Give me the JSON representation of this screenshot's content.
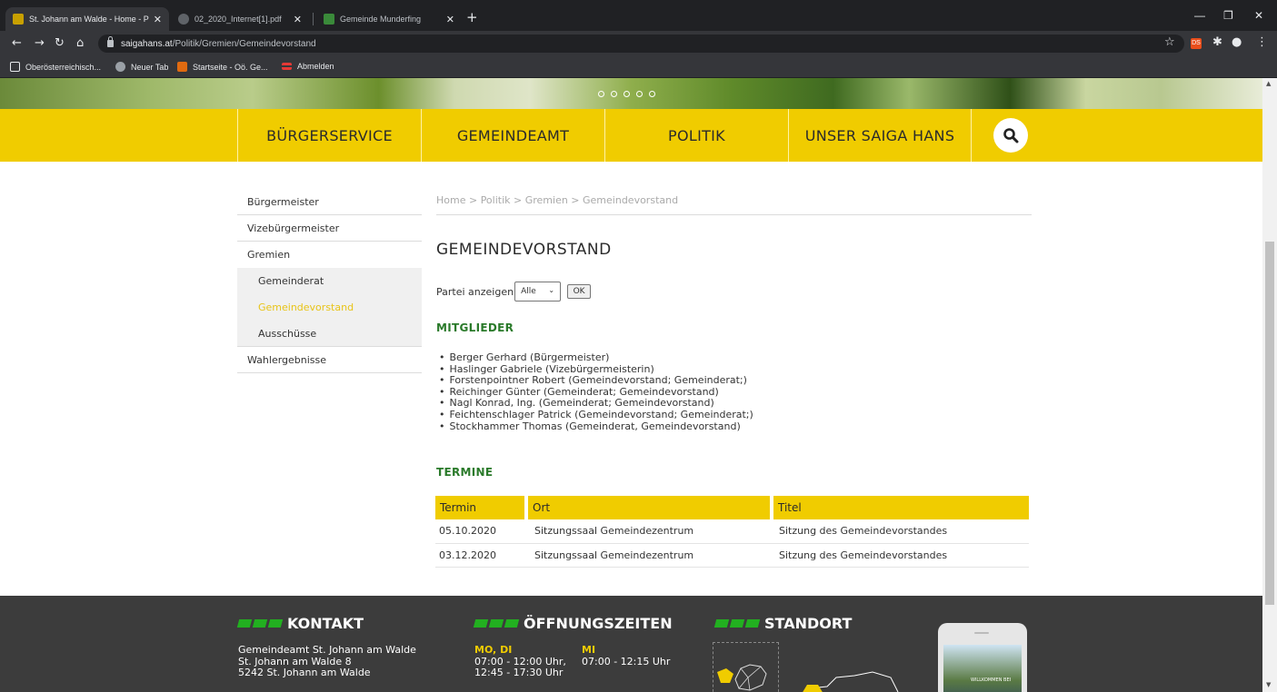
{
  "browser": {
    "tabs": [
      {
        "title": "St. Johann am Walde - Home - P",
        "active": true
      },
      {
        "title": "02_2020_Internet[1].pdf",
        "active": false
      },
      {
        "title": "Gemeinde Munderfing",
        "active": false
      }
    ],
    "url_host": "saigahans.at",
    "url_path": "/Politik/Gremien/Gemeindevorstand",
    "bookmarks": [
      "Oberösterreichisch...",
      "Neuer Tab",
      "Startseite - Oö. Ge...",
      "Abmelden"
    ],
    "extension_badge": "DS"
  },
  "nav": {
    "items": [
      "BÜRGERSERVICE",
      "GEMEINDEAMT",
      "POLITIK",
      "UNSER SAIGA HANS"
    ]
  },
  "sidebar": {
    "items": [
      "Bürgermeister",
      "Vizebürgermeister",
      "Gremien"
    ],
    "children": [
      "Gemeinderat",
      "Gemeindevorstand",
      "Ausschüsse"
    ],
    "active_child": "Gemeindevorstand",
    "last_item": "Wahlergebnisse"
  },
  "breadcrumb": "Home > Politik > Gremien > Gemeindevorstand",
  "page_title": "GEMEINDEVORSTAND",
  "filter": {
    "label": "Partei anzeigen",
    "selected": "Alle",
    "ok_label": "OK"
  },
  "members_heading": "MITGLIEDER",
  "members": [
    "Berger Gerhard (Bürgermeister)",
    "Haslinger Gabriele (Vizebürgermeisterin)",
    "Forstenpointner Robert (Gemeindevorstand; Gemeinderat;)",
    "Reichinger Günter (Gemeinderat; Gemeindevorstand)",
    "Nagl Konrad, Ing. (Gemeinderat; Gemeindevorstand)",
    "Feichtenschlager Patrick (Gemeindevorstand; Gemeinderat;)",
    "Stockhammer Thomas (Gemeinderat, Gemeindevorstand)"
  ],
  "termine_heading": "TERMINE",
  "termine": {
    "headers": [
      "Termin",
      "Ort",
      "Titel"
    ],
    "rows": [
      [
        "05.10.2020",
        "Sitzungssaal Gemeindezentrum",
        "Sitzung des Gemeindevorstandes"
      ],
      [
        "03.12.2020",
        "Sitzungssaal Gemeindezentrum",
        "Sitzung des Gemeindevorstandes"
      ]
    ]
  },
  "footer": {
    "kontakt_title": "KONTAKT",
    "kontakt_lines": [
      "Gemeindeamt St. Johann am Walde",
      "St. Johann am Walde 8",
      "5242 St. Johann am Walde"
    ],
    "oeffnung_title": "ÖFFNUNGSZEITEN",
    "oeffnung_day1": "MO, DI",
    "oeffnung_time1a": "07:00 - 12:00 Uhr,",
    "oeffnung_time1b": "12:45 - 17:30 Uhr",
    "oeffnung_day2": "MI",
    "oeffnung_time2": "07:00 - 12:15 Uhr",
    "standort_title": "STANDORT",
    "phone_text": "WILLKOMMEN BEI"
  },
  "colors": {
    "brand_yellow": "#f0cc00",
    "brand_green": "#2a7a2a",
    "footer_bg": "#3c3c3c",
    "accent_green": "#22b020"
  }
}
